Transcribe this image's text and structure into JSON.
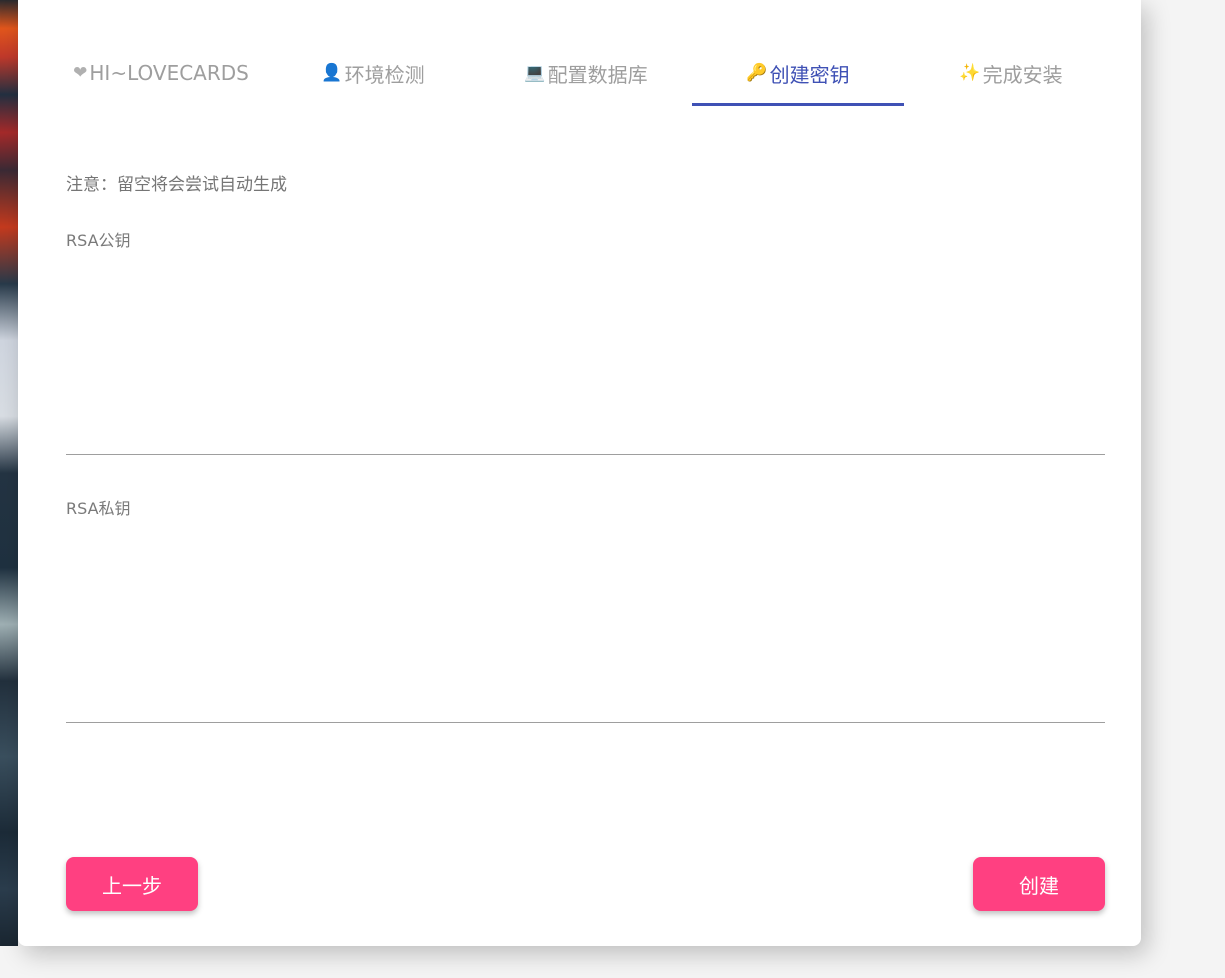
{
  "tabs": [
    {
      "icon": "heart-icon",
      "glyph": "❤",
      "label": "HI~LOVECARDS"
    },
    {
      "icon": "person-icon",
      "glyph": "👤",
      "label": "环境检测"
    },
    {
      "icon": "laptop-icon",
      "glyph": "💻",
      "label": "配置数据库"
    },
    {
      "icon": "key-icon",
      "glyph": "🔑",
      "label": "创建密钥"
    },
    {
      "icon": "party-icon",
      "glyph": "✨",
      "label": "完成安装"
    }
  ],
  "active_tab": "创建密钥",
  "note": "注意：留空将会尝试自动生成",
  "form": {
    "public_key_label": "RSA公钥",
    "public_key_value": "",
    "private_key_label": "RSA私钥",
    "private_key_value": ""
  },
  "buttons": {
    "prev_label": "上一步",
    "create_label": "创建"
  },
  "colors": {
    "accent": "#3f51b5",
    "button": "#ff4081",
    "tab_inactive": "#9e9e9e"
  }
}
